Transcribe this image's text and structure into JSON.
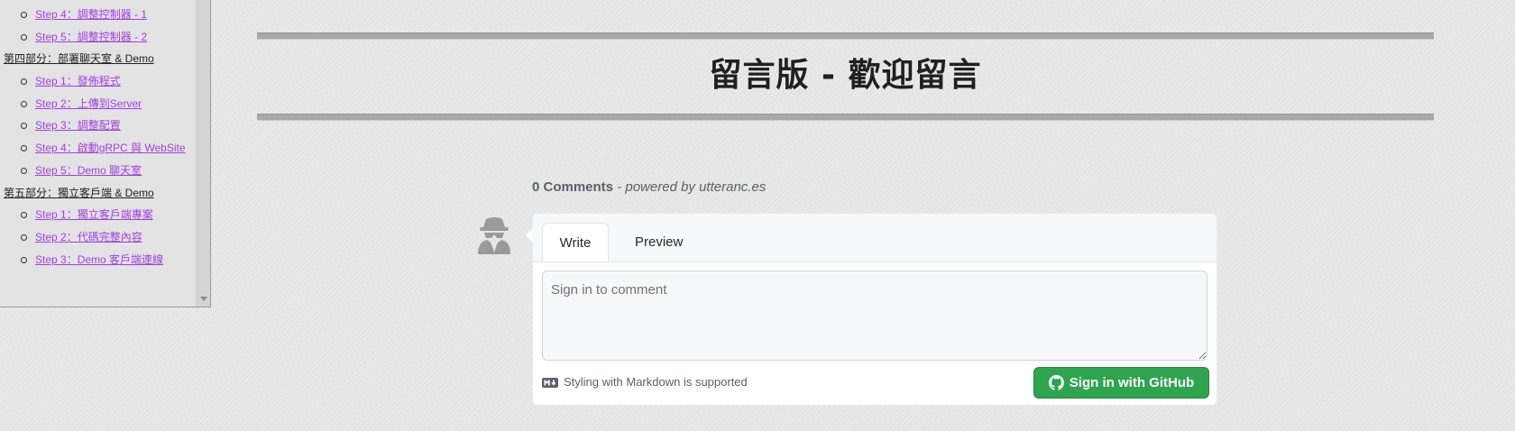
{
  "toc": {
    "items": [
      {
        "kind": "sub",
        "label": "Step 4：調整控制器 - 1"
      },
      {
        "kind": "sub",
        "label": "Step 5：調整控制器 - 2"
      },
      {
        "kind": "part",
        "label": "第四部分：部署聊天室 & Demo"
      },
      {
        "kind": "sub",
        "label": "Step 1：發佈程式"
      },
      {
        "kind": "sub",
        "label": "Step 2：上傳到Server"
      },
      {
        "kind": "sub",
        "label": "Step 3：調整配置"
      },
      {
        "kind": "sub",
        "label": "Step 4：啟動gRPC 與 WebSite"
      },
      {
        "kind": "sub",
        "label": "Step 5：Demo 聊天室"
      },
      {
        "kind": "part",
        "label": "第五部分：獨立客戶端 & Demo"
      },
      {
        "kind": "sub",
        "label": "Step 1：獨立客戶端專案"
      },
      {
        "kind": "sub",
        "label": "Step 2：代碼完整內容"
      },
      {
        "kind": "sub",
        "label": "Step 3：Demo 客戶端連線"
      }
    ]
  },
  "page": {
    "title": "留言版 - 歡迎留言"
  },
  "comments": {
    "count_label": "0 Comments",
    "powered_by": "- powered by utteranc.es",
    "tabs": {
      "write": "Write",
      "preview": "Preview"
    },
    "input_placeholder": "Sign in to comment",
    "markdown_note": "Styling with Markdown is supported",
    "signin_label": "Sign in with GitHub",
    "avatar_icon": "anonymous-user-icon",
    "markdown_icon": "markdown-icon",
    "github_icon": "github-icon"
  },
  "colors": {
    "background": "#e7e7e7",
    "sub_link": "#a040e0",
    "signin_button": "#2ea44f"
  }
}
